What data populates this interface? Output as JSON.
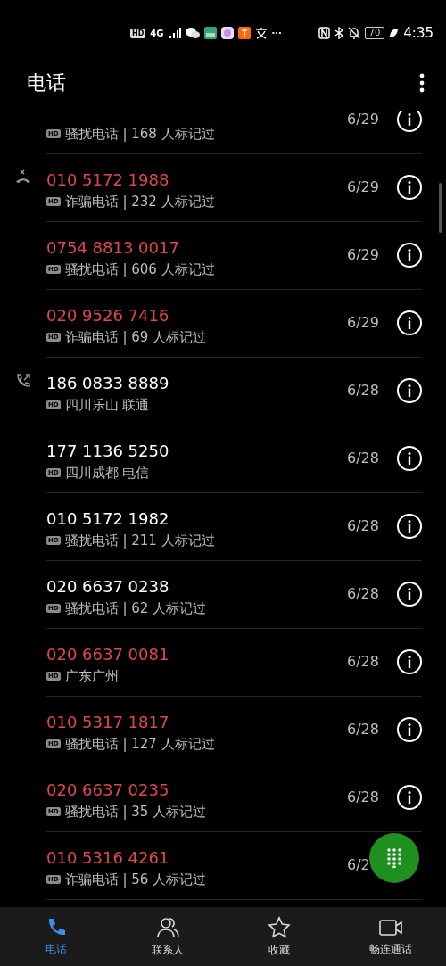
{
  "status_bar": {
    "hd": "HD",
    "network": "4G",
    "more": "···",
    "battery": "70",
    "time": "4:35"
  },
  "header": {
    "title": "电话"
  },
  "calls": [
    {
      "kind": "plain",
      "badge": "HD",
      "detail": "骚扰电话 | 168 人标记过",
      "date": "6/29",
      "info": true
    },
    {
      "kind": "rejected",
      "number": "010 5172 1988",
      "spam": true,
      "badge": "HD",
      "detail": "诈骗电话 | 232 人标记过",
      "date": "6/29",
      "info": true
    },
    {
      "kind": "plain",
      "number": "0754 8813 0017",
      "spam": true,
      "badge": "HD",
      "detail": "骚扰电话 | 606 人标记过",
      "date": "6/29",
      "info": true
    },
    {
      "kind": "plain",
      "number": "020 9526 7416",
      "spam": true,
      "badge": "HD",
      "detail": "诈骗电话 | 69 人标记过",
      "date": "6/29",
      "info": true
    },
    {
      "kind": "outgoing",
      "number": "186 0833 8889",
      "spam": false,
      "badge": "HD",
      "detail": "四川乐山 联通",
      "date": "6/28",
      "info": true
    },
    {
      "kind": "plain",
      "number": "177 1136 5250",
      "spam": false,
      "badge": "HD",
      "detail": "四川成都 电信",
      "date": "6/28",
      "info": true
    },
    {
      "kind": "plain",
      "number": "010 5172 1982",
      "spam": false,
      "badge": "HD",
      "detail": "骚扰电话 | 211 人标记过",
      "date": "6/28",
      "info": true
    },
    {
      "kind": "plain",
      "number": "020 6637 0238",
      "spam": false,
      "badge": "HD",
      "detail": "骚扰电话 | 62 人标记过",
      "date": "6/28",
      "info": true
    },
    {
      "kind": "plain",
      "number": "020 6637 0081",
      "spam": true,
      "badge": "HD",
      "detail": "广东广州",
      "date": "6/28",
      "info": true
    },
    {
      "kind": "plain",
      "number": "010 5317 1817",
      "spam": true,
      "badge": "HD",
      "detail": "骚扰电话 | 127 人标记过",
      "date": "6/28",
      "info": true
    },
    {
      "kind": "plain",
      "number": "020 6637 0235",
      "spam": true,
      "badge": "HD",
      "detail": "骚扰电话 | 35 人标记过",
      "date": "6/28",
      "info": true
    },
    {
      "kind": "plain",
      "number": "010 5316 4261",
      "spam": true,
      "badge": "HD",
      "detail": "诈骗电话 | 56 人标记过",
      "date": "6/2",
      "info": false
    }
  ],
  "nav": [
    {
      "kind": "phone",
      "label": "电话",
      "selected": true
    },
    {
      "kind": "contacts",
      "label": "联系人",
      "selected": false
    },
    {
      "kind": "favorites",
      "label": "收藏",
      "selected": false
    },
    {
      "kind": "video",
      "label": "畅连通话",
      "selected": false
    }
  ]
}
